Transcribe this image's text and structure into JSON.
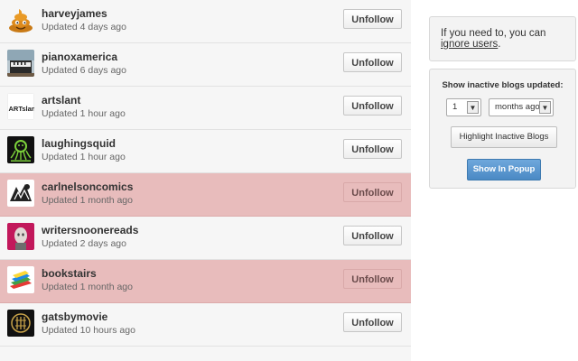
{
  "blogs": [
    {
      "name": "harveyjames",
      "updated": "Updated 4 days ago",
      "inactive": false,
      "avatar_icon": "poop-emoji-icon"
    },
    {
      "name": "pianoxamerica",
      "updated": "Updated 6 days ago",
      "inactive": false,
      "avatar_icon": "piano-photo-avatar"
    },
    {
      "name": "artslant",
      "updated": "Updated 1 hour ago",
      "inactive": false,
      "avatar_icon": "artslant-logo"
    },
    {
      "name": "laughingsquid",
      "updated": "Updated 1 hour ago",
      "inactive": false,
      "avatar_icon": "laughingsquid-logo"
    },
    {
      "name": "carlnelsoncomics",
      "updated": "Updated 1 month ago",
      "inactive": true,
      "avatar_icon": "comic-avatar"
    },
    {
      "name": "writersnoonereads",
      "updated": "Updated 2 days ago",
      "inactive": false,
      "avatar_icon": "face-avatar"
    },
    {
      "name": "bookstairs",
      "updated": "Updated 1 month ago",
      "inactive": true,
      "avatar_icon": "books-avatar"
    },
    {
      "name": "gatsbymovie",
      "updated": "Updated 10 hours ago",
      "inactive": false,
      "avatar_icon": "gatsby-logo"
    }
  ],
  "unfollow_label": "Unfollow",
  "artslant_logo_text": "ARTslant",
  "info": {
    "text_before": "If you need to, you can",
    "link": "ignore users",
    "text_after": "."
  },
  "inactive_panel": {
    "title": "Show inactive blogs updated:",
    "count_value": "1",
    "unit_value": "months ago",
    "highlight_label": "Highlight Inactive Blogs",
    "popup_label": "Show In Popup"
  },
  "colors": {
    "inactive_row": "#e8bcbc",
    "popup_button": "#4a89c4"
  }
}
